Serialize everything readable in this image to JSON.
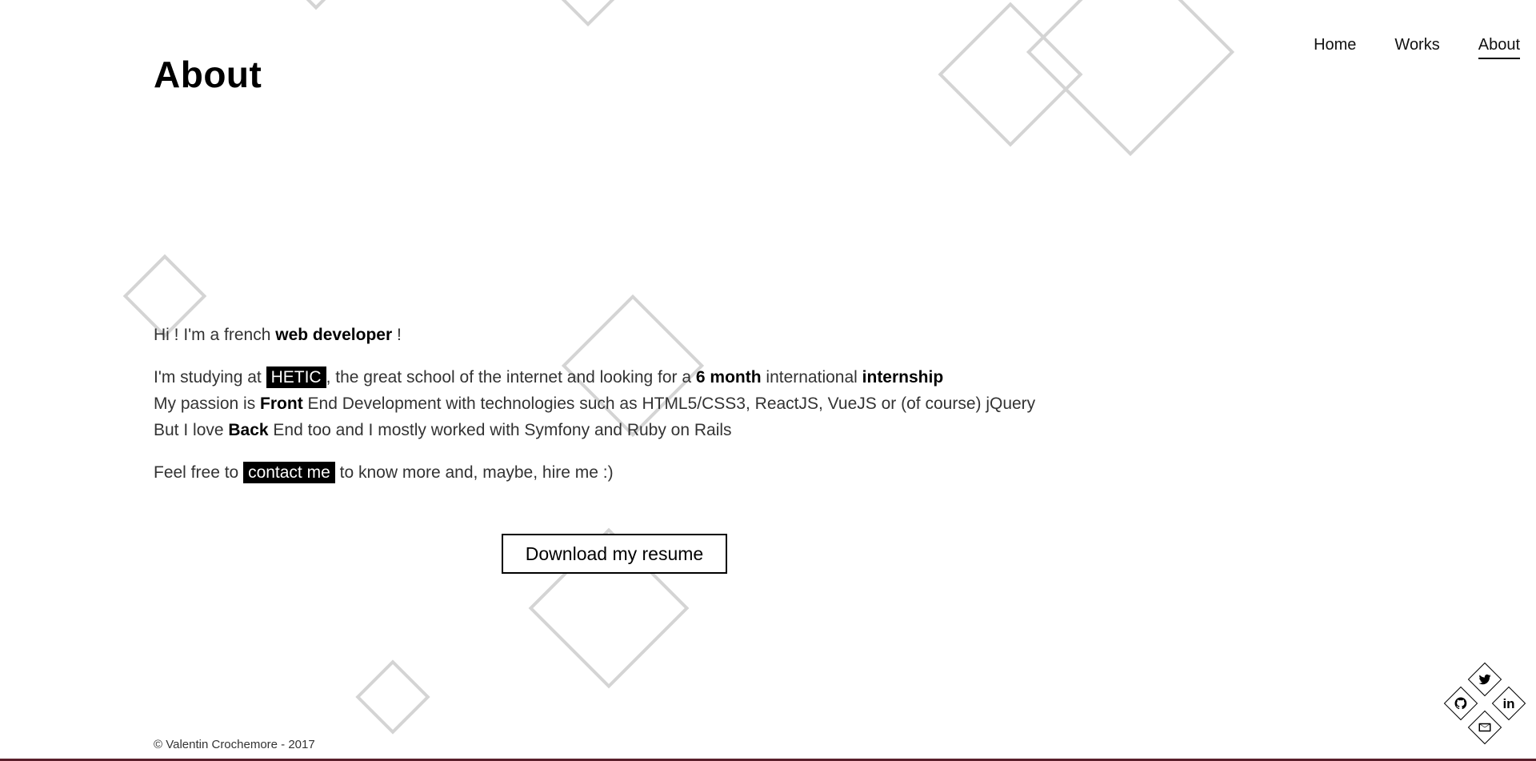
{
  "page": {
    "title": "About"
  },
  "nav": {
    "items": [
      {
        "label": "Home"
      },
      {
        "label": "Works"
      },
      {
        "label": "About"
      }
    ]
  },
  "intro": {
    "line1_pre": "Hi ! I'm a french ",
    "line1_strong": "web developer",
    "line1_post": " !"
  },
  "study": {
    "pre": "I'm studying at ",
    "school": "HETIC",
    "mid": ", the great school of the internet and looking for a ",
    "duration": "6 month",
    "mid2": " international ",
    "internship": "internship"
  },
  "passion": {
    "pre": "My passion is ",
    "strong": "Front",
    "post": " End Development with technologies such as HTML5/CSS3, ReactJS, VueJS or (of course) jQuery"
  },
  "backend": {
    "pre": "But I love ",
    "strong": "Back",
    "post": " End too and I mostly worked with Symfony and Ruby on Rails"
  },
  "contact": {
    "pre": "Feel free to ",
    "link": "contact me",
    "post": " to know more and, maybe, hire me :)"
  },
  "download": {
    "label": "Download my resume"
  },
  "footer": {
    "copyright": "© Valentin Crochemore - 2017"
  },
  "social": {
    "icons": [
      "twitter-icon",
      "github-icon",
      "linkedin-icon",
      "mail-icon"
    ],
    "linkedin_text": "in"
  },
  "colors": {
    "text": "#333333",
    "accent": "#000000",
    "shape_stroke": "#d4d4d4",
    "bottom_line": "#5a1f2b"
  }
}
